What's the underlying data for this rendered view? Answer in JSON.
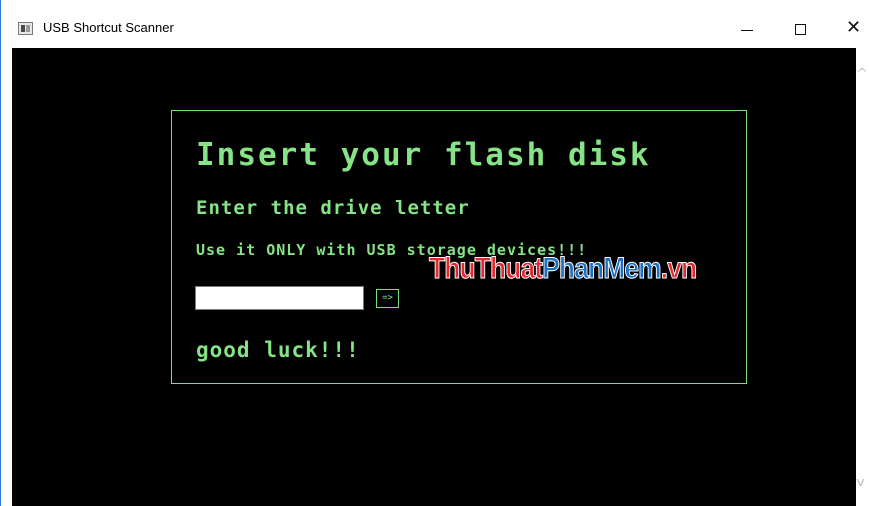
{
  "window": {
    "title": "USB Shortcut Scanner",
    "minimize_label": "—",
    "maximize_label": "☐",
    "close_label": "✕"
  },
  "app": {
    "heading": "Insert your flash disk",
    "subheading": "Enter the drive letter",
    "warning": "Use it ONLY with USB storage devices!!!",
    "drive_input_value": "",
    "submit_label": "=>",
    "footer": "good luck!!!"
  },
  "watermark": {
    "part1": "ThuThuat",
    "part2": "PhanMem",
    "part3": ".vn"
  },
  "scrollbar": {
    "up_arrow": "^",
    "down_arrow": "v"
  },
  "colors": {
    "terminal_green": "#86e386",
    "background": "#000000",
    "watermark_red": "#e8262f",
    "watermark_blue": "#1d6fc2"
  }
}
